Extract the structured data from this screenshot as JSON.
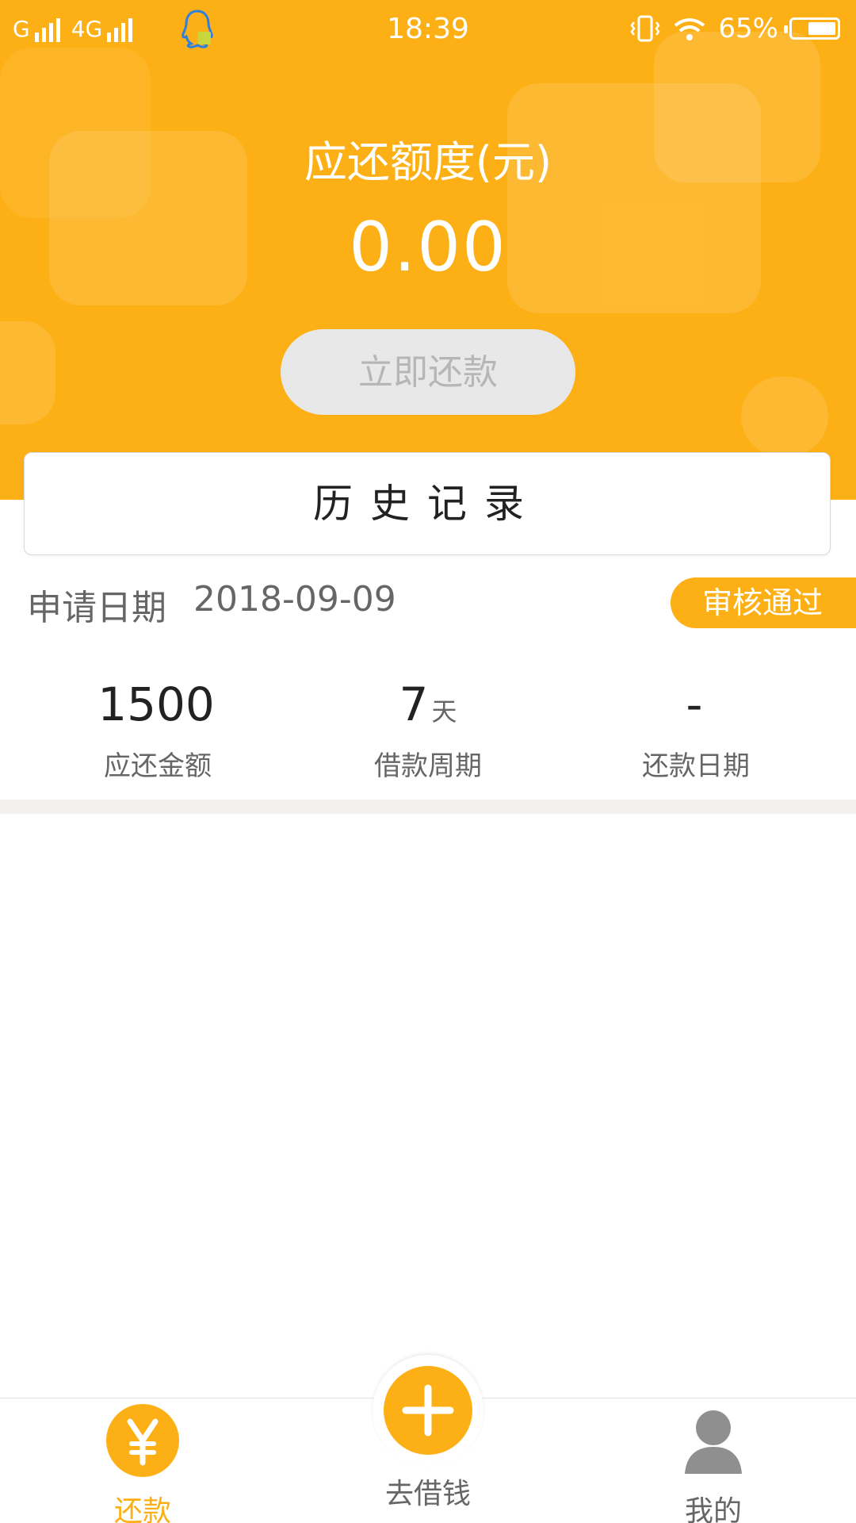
{
  "status_bar": {
    "carrier": "G",
    "network": "4G",
    "time": "18:39",
    "battery": "65%",
    "battery_level": 0.65
  },
  "header": {
    "due_label": "应还额度(元)",
    "due_amount": "0.00",
    "repay_button": "立即还款"
  },
  "history": {
    "label": "历史记录"
  },
  "application": {
    "date_label": "申请日期",
    "date_value": "2018-09-09",
    "status": "审核通过"
  },
  "stats": [
    {
      "value": "1500",
      "unit": "",
      "label": "应还金额"
    },
    {
      "value": "7",
      "unit": "天",
      "label": "借款周期"
    },
    {
      "value": "-",
      "unit": "",
      "label": "还款日期"
    }
  ],
  "bottom_nav": {
    "repay": "还款",
    "borrow": "去借钱",
    "mine": "我的"
  },
  "colors": {
    "accent": "#fdb016",
    "button_disabled_bg": "#e8e8e8",
    "text_dark": "#222222",
    "text_muted": "#666666"
  },
  "icons": {
    "qq": "qq-notification-icon",
    "vibrate": "vibrate-icon",
    "wifi": "wifi-icon",
    "battery": "battery-icon",
    "repay_nav": "yen-icon",
    "borrow_nav": "plus-icon",
    "mine_nav": "user-icon"
  }
}
